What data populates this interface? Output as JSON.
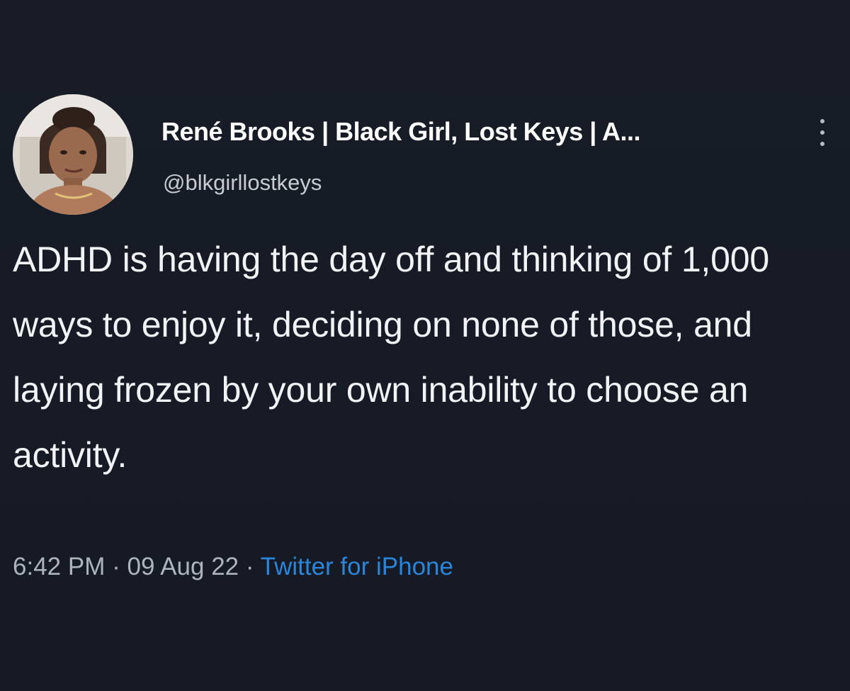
{
  "author": {
    "display_name": "René Brooks | Black Girl, Lost Keys | A...",
    "handle": "@blkgirllostkeys"
  },
  "tweet": {
    "text": "ADHD is having the day off and thinking of 1,000 ways to enjoy it, deciding on none of those, and laying frozen by your own inability to choose an activity.",
    "time": "6:42 PM",
    "separator": "·",
    "date": "09 Aug 22",
    "source": "Twitter for iPhone"
  },
  "icons": {
    "more": "vertical-ellipsis-icon"
  },
  "colors": {
    "background": "#161b26",
    "text": "#f2f3f5",
    "secondary_text": "#aeb4bc",
    "link": "#2b86d9"
  }
}
